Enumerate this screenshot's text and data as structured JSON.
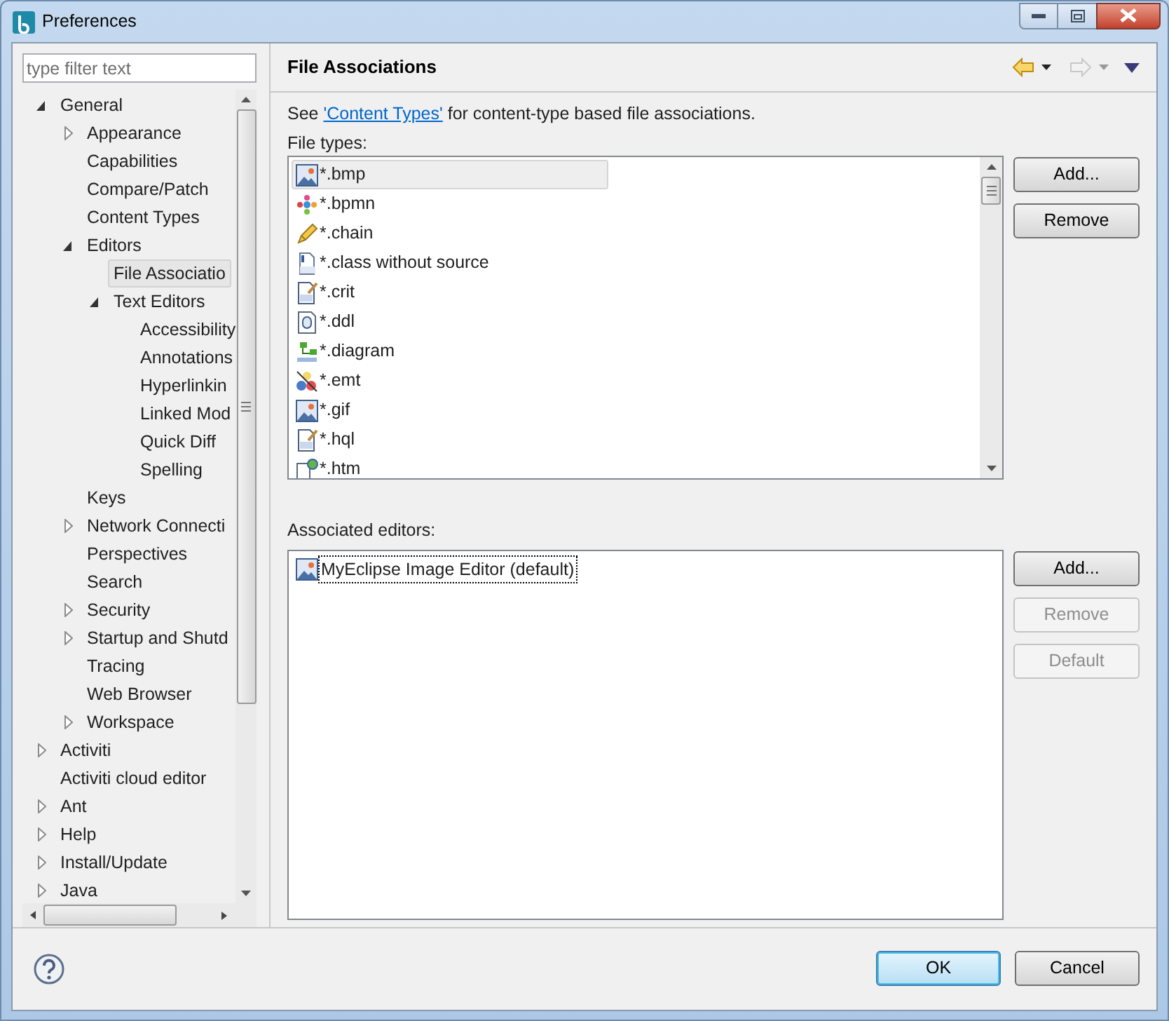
{
  "window": {
    "title": "Preferences"
  },
  "filter": {
    "placeholder": "type filter text"
  },
  "tree": [
    {
      "label": "General",
      "expanded": true,
      "selected": false,
      "children": [
        {
          "label": "Appearance",
          "expanded": false,
          "selected": false
        },
        {
          "label": "Capabilities",
          "selected": false
        },
        {
          "label": "Compare/Patch",
          "selected": false
        },
        {
          "label": "Content Types",
          "selected": false
        },
        {
          "label": "Editors",
          "expanded": true,
          "selected": false,
          "children": [
            {
              "label": "File Associatio",
              "selected": true
            },
            {
              "label": "Text Editors",
              "expanded": true,
              "selected": false,
              "children": [
                {
                  "label": "Accessibility",
                  "selected": false
                },
                {
                  "label": "Annotations",
                  "selected": false
                },
                {
                  "label": "Hyperlinkin",
                  "selected": false
                },
                {
                  "label": "Linked Mod",
                  "selected": false
                },
                {
                  "label": "Quick Diff",
                  "selected": false
                },
                {
                  "label": "Spelling",
                  "selected": false
                }
              ]
            }
          ]
        },
        {
          "label": "Keys",
          "selected": false
        },
        {
          "label": "Network Connecti",
          "expanded": false,
          "selected": false
        },
        {
          "label": "Perspectives",
          "selected": false
        },
        {
          "label": "Search",
          "selected": false
        },
        {
          "label": "Security",
          "expanded": false,
          "selected": false
        },
        {
          "label": "Startup and Shutd",
          "expanded": false,
          "selected": false
        },
        {
          "label": "Tracing",
          "selected": false
        },
        {
          "label": "Web Browser",
          "selected": false
        },
        {
          "label": "Workspace",
          "expanded": false,
          "selected": false
        }
      ]
    },
    {
      "label": "Activiti",
      "expanded": false,
      "selected": false
    },
    {
      "label": "Activiti cloud editor",
      "selected": false
    },
    {
      "label": "Ant",
      "expanded": false,
      "selected": false
    },
    {
      "label": "Help",
      "expanded": false,
      "selected": false
    },
    {
      "label": "Install/Update",
      "expanded": false,
      "selected": false
    },
    {
      "label": "Java",
      "expanded": false,
      "selected": false
    }
  ],
  "page": {
    "title": "File Associations",
    "description": {
      "before": "See ",
      "link": "'Content Types'",
      "after": " for content-type based file associations."
    },
    "file_types": {
      "label": "File types:",
      "items": [
        {
          "name": "*.bmp",
          "kind": "image",
          "selected": true
        },
        {
          "name": "*.bpmn",
          "kind": "bpmn",
          "selected": false
        },
        {
          "name": "*.chain",
          "kind": "chain",
          "selected": false
        },
        {
          "name": "*.class without source",
          "kind": "class",
          "selected": false
        },
        {
          "name": "*.crit",
          "kind": "doc",
          "selected": false
        },
        {
          "name": "*.ddl",
          "kind": "ddl",
          "selected": false
        },
        {
          "name": "*.diagram",
          "kind": "diagram",
          "selected": false
        },
        {
          "name": "*.emt",
          "kind": "emt",
          "selected": false
        },
        {
          "name": "*.gif",
          "kind": "image",
          "selected": false
        },
        {
          "name": "*.hql",
          "kind": "doc",
          "selected": false
        },
        {
          "name": "*.htm",
          "kind": "htm",
          "selected": false
        }
      ],
      "buttons": [
        {
          "label": "Add...",
          "disabled": false
        },
        {
          "label": "Remove",
          "disabled": false
        }
      ]
    },
    "editors": {
      "label": "Associated editors:",
      "items": [
        {
          "name": "MyEclipse Image Editor (default)",
          "kind": "image",
          "selected": true
        }
      ],
      "buttons": [
        {
          "label": "Add...",
          "disabled": false
        },
        {
          "label": "Remove",
          "disabled": true
        },
        {
          "label": "Default",
          "disabled": true
        }
      ]
    }
  },
  "footer": {
    "buttons": [
      {
        "label": "OK",
        "default": true
      },
      {
        "label": "Cancel",
        "default": false
      }
    ]
  }
}
